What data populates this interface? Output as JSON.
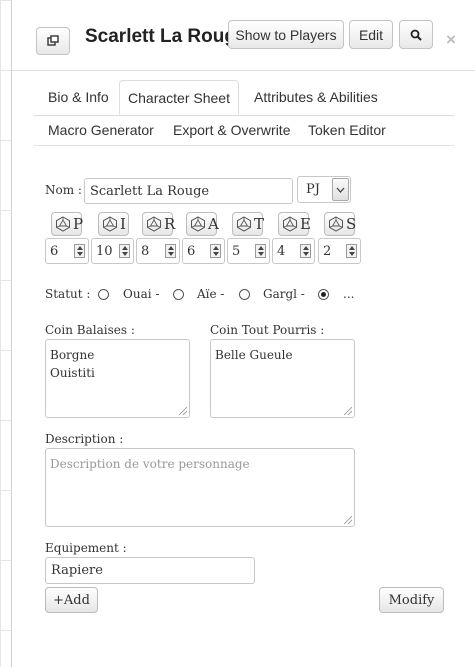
{
  "header": {
    "title": "Scarlett La Rouge",
    "show_players_label": "Show to Players",
    "edit_label": "Edit",
    "close_glyph": "×"
  },
  "tabs": [
    {
      "label": "Bio & Info",
      "active": false
    },
    {
      "label": "Character Sheet",
      "active": true
    },
    {
      "label": "Attributes & Abilities",
      "active": false
    },
    {
      "label": "Macro Generator",
      "active": false
    },
    {
      "label": "Export & Overwrite",
      "active": false
    },
    {
      "label": "Token Editor",
      "active": false
    }
  ],
  "sheet": {
    "nom_label": "Nom :",
    "nom_value": "Scarlett La Rouge",
    "type_value": "PJ",
    "stats": [
      {
        "letter": "P",
        "value": "6"
      },
      {
        "letter": "I",
        "value": "10"
      },
      {
        "letter": "R",
        "value": "8"
      },
      {
        "letter": "A",
        "value": "6"
      },
      {
        "letter": "T",
        "value": "5"
      },
      {
        "letter": "E",
        "value": "4"
      },
      {
        "letter": "S",
        "value": "2"
      }
    ],
    "statut_label": "Statut :",
    "statut_options": [
      "Ouai -",
      "Aïe -",
      "Gargl -",
      "..."
    ],
    "statut_selected": 3,
    "coin_balaises_label": "Coin Balaises :",
    "coin_balaises_lines": [
      "Borgne",
      "Ouistiti"
    ],
    "coin_pourris_label": "Coin Tout Pourris :",
    "coin_pourris_lines": [
      "Belle Gueule"
    ],
    "description_label": "Description :",
    "description_placeholder": "Description de votre personnage",
    "equipement_label": "Equipement :",
    "equipement_value": "Rapiere",
    "add_label": "+Add",
    "modify_label": "Modify"
  },
  "icons": {
    "popout": "popout-icon",
    "search": "search-icon",
    "close": "close-icon",
    "dice": "d20-icon"
  }
}
